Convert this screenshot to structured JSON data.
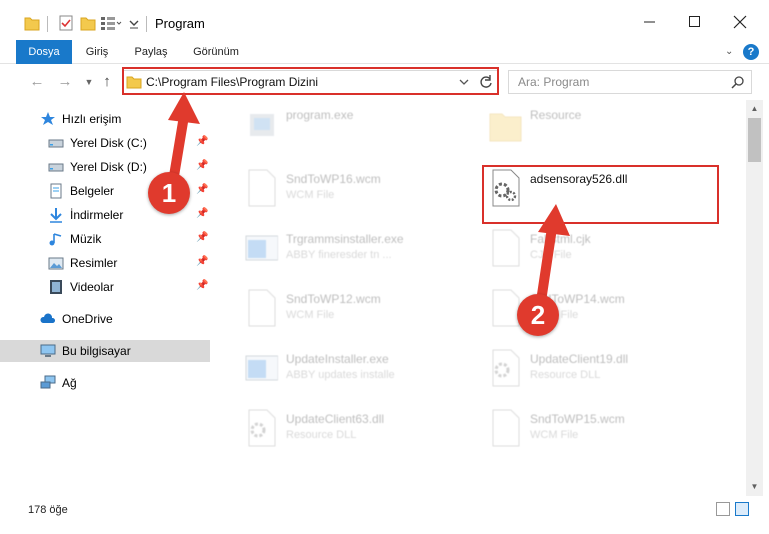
{
  "window": {
    "title": "Program",
    "accent": "#1979ca"
  },
  "ribbon": {
    "tabs": [
      {
        "label": "Dosya",
        "active": true
      },
      {
        "label": "Giriş",
        "active": false
      },
      {
        "label": "Paylaş",
        "active": false
      },
      {
        "label": "Görünüm",
        "active": false
      }
    ],
    "help_label": "?"
  },
  "address": {
    "path": "C:\\Program Files\\Program Dizini",
    "search_placeholder": "Ara: Program"
  },
  "sidebar": {
    "quick_access": "Hızlı erişim",
    "items": [
      {
        "label": "Yerel Disk (C:)",
        "icon": "drive-icon",
        "pinned": true
      },
      {
        "label": "Yerel Disk (D:)",
        "icon": "drive-icon",
        "pinned": true
      },
      {
        "label": "Belgeler",
        "icon": "documents-icon",
        "pinned": true
      },
      {
        "label": "İndirmeler",
        "icon": "download-icon",
        "pinned": true
      },
      {
        "label": "Müzik",
        "icon": "music-icon",
        "pinned": true
      },
      {
        "label": "Resimler",
        "icon": "pictures-icon",
        "pinned": true
      },
      {
        "label": "Videolar",
        "icon": "videos-icon",
        "pinned": true
      }
    ],
    "onedrive": "OneDrive",
    "this_pc": "Bu bilgisayar",
    "network": "Ağ"
  },
  "files": [
    {
      "name": "program.exe",
      "type": "",
      "icon": "exe-icon",
      "highlight": false
    },
    {
      "name": "Resource",
      "type": "",
      "icon": "folder-icon",
      "highlight": false
    },
    {
      "name": "SndToWP16.wcm",
      "type": "WCM File",
      "icon": "blank-file-icon",
      "highlight": false
    },
    {
      "name": "adsensoray526.dll",
      "type": "",
      "icon": "dll-icon",
      "highlight": true
    },
    {
      "name": "Trgrammsinstaller.exe",
      "type": "ABBY fineresder tn ...",
      "icon": "installer-icon",
      "highlight": false
    },
    {
      "name": "Fabstml.cjk",
      "type": "CJK File",
      "icon": "blank-file-icon",
      "highlight": false
    },
    {
      "name": "SndToWP12.wcm",
      "type": "WCM File",
      "icon": "blank-file-icon",
      "highlight": false
    },
    {
      "name": "SndToWP14.wcm",
      "type": "WCM File",
      "icon": "blank-file-icon",
      "highlight": false
    },
    {
      "name": "UpdateInstaller.exe",
      "type": "ABBY updates installe",
      "icon": "installer-icon",
      "highlight": false
    },
    {
      "name": "UpdateClient19.dll",
      "type": "Resource DLL",
      "icon": "dll-icon",
      "highlight": false
    },
    {
      "name": "UpdateClient63.dll",
      "type": "Resource DLL",
      "icon": "dll-icon",
      "highlight": false
    },
    {
      "name": "SndToWP15.wcm",
      "type": "WCM File",
      "icon": "blank-file-icon",
      "highlight": false
    }
  ],
  "status": {
    "item_count": "178 öğe"
  },
  "annotations": {
    "step1": "1",
    "step2": "2",
    "color": "#e03a2d"
  }
}
